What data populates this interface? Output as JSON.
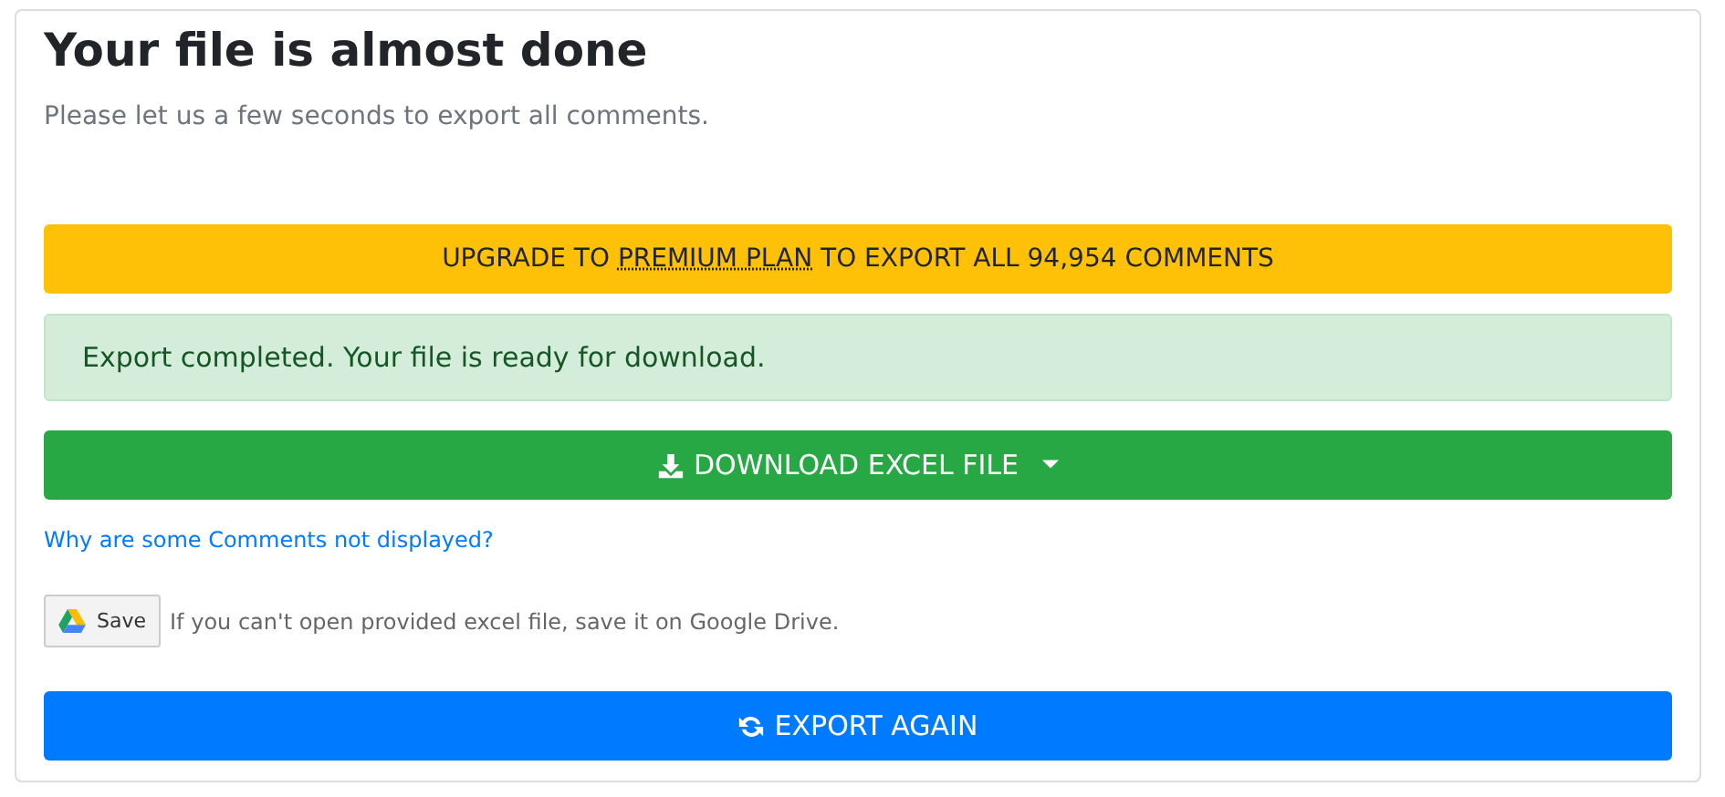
{
  "title": "Your file is almost done",
  "subtitle": "Please let us a few seconds to export all comments.",
  "upgrade": {
    "before": "UPGRADE TO",
    "link": "PREMIUM PLAN",
    "after": "TO EXPORT ALL 94,954 COMMENTS"
  },
  "alert": "Export completed. Your file is ready for download.",
  "download_button": {
    "label": "DOWNLOAD EXCEL FILE",
    "dropdown": true
  },
  "help_link": "Why are some Comments not displayed?",
  "drive": {
    "button": "Save",
    "note": "If you can't open provided excel file, save it on Google Drive."
  },
  "export_button": "EXPORT AGAIN"
}
